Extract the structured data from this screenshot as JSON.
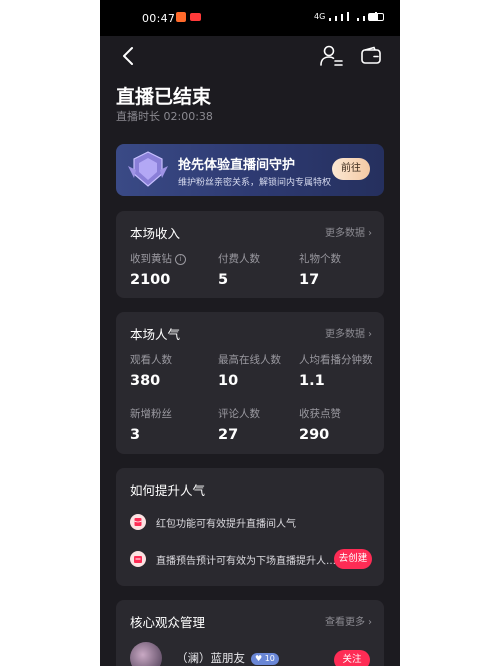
{
  "status_bar": {
    "time": "00:47",
    "network": "4G"
  },
  "header": {
    "title": "直播已结束",
    "duration": "直播时长 02:00:38"
  },
  "banner": {
    "title": "抢先体验直播间守护",
    "subtitle": "维护粉丝亲密关系，解锁间内专属特权",
    "button_label": "前往"
  },
  "income": {
    "title": "本场收入",
    "more_label": "更多数据",
    "stats": [
      {
        "label": "收到黄钻",
        "value": "2100"
      },
      {
        "label": "付费人数",
        "value": "5"
      },
      {
        "label": "礼物个数",
        "value": "17"
      }
    ]
  },
  "popularity": {
    "title": "本场人气",
    "more_label": "更多数据",
    "stats": [
      {
        "label": "观看人数",
        "value": "380"
      },
      {
        "label": "最高在线人数",
        "value": "10"
      },
      {
        "label": "人均看播分钟数",
        "value": "1.1"
      },
      {
        "label": "新增粉丝",
        "value": "3"
      },
      {
        "label": "评论人数",
        "value": "27"
      },
      {
        "label": "收获点赞",
        "value": "290"
      }
    ]
  },
  "tips": {
    "title": "如何提升人气",
    "items": [
      {
        "text": "红包功能可有效提升直播间人气"
      },
      {
        "text": "直播预告预计可有效为下场直播提升人…",
        "button_label": "去创建"
      }
    ]
  },
  "audience": {
    "title": "核心观众管理",
    "more_label": "查看更多",
    "user": {
      "name": "（澜）蓝朋友",
      "level": "10",
      "button_label": "关注"
    }
  },
  "colors": {
    "accent": "#fe2c55",
    "background": "#1c1b20",
    "card": "#2a292f"
  }
}
